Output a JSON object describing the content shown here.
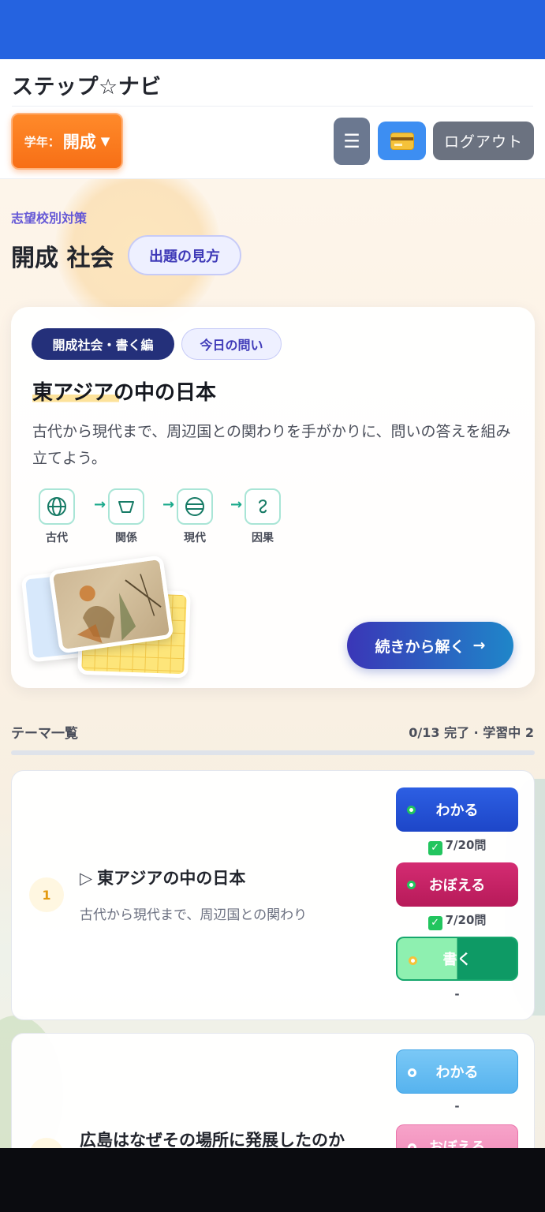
{
  "header": {
    "app_title": "ステップ☆ナビ",
    "grade_label": "学年：",
    "grade_value": "開成",
    "grade_caret": "▼",
    "menu_icon": "☰",
    "logout_label": "ログアウト"
  },
  "page": {
    "eyebrow": "志望校別対策",
    "title": "開成 社会",
    "howto_label": "出題の見方"
  },
  "hero": {
    "chip_primary": "開成社会・書く編",
    "chip_secondary": "今日の問い",
    "title": "東アジアの中の日本",
    "description": "古代から現代まで、周辺国との関わりを手がかりに、問いの答えを組み立てよう。",
    "flow": [
      {
        "label": "古代",
        "icon": "globe-icon"
      },
      {
        "label": "関係",
        "icon": "bowl-icon"
      },
      {
        "label": "現代",
        "icon": "circle-lines-icon"
      },
      {
        "label": "因果",
        "icon": "curl-icon"
      }
    ],
    "flow_arrow": "→",
    "continue_label": "続きから解く",
    "continue_arrow": "→"
  },
  "themes_section": {
    "title": "テーマ一覧",
    "stats": "0/13 完了 · 学習中 2",
    "progress": 0
  },
  "themes": [
    {
      "number": "1",
      "marker": "▷",
      "title": "東アジアの中の日本",
      "subtitle": "古代から現代まで、周辺国との関わり",
      "wakaru_label": "わかる",
      "wakaru_status": "7/20問",
      "oboeru_label": "おぼえる",
      "oboeru_status": "7/20問",
      "kaku_label": "書く",
      "kaku_status": "-"
    },
    {
      "title": "広島はなぜその場所に発展したのか",
      "wakaru_label": "わかる",
      "wakaru_status": "-",
      "oboeru_label": "おぼえる"
    }
  ],
  "colors": {
    "topbar": "#2563e0",
    "accent_orange": "#f76f16",
    "accent_indigo": "#3a36b7",
    "accent_teal": "#1aa98b"
  }
}
